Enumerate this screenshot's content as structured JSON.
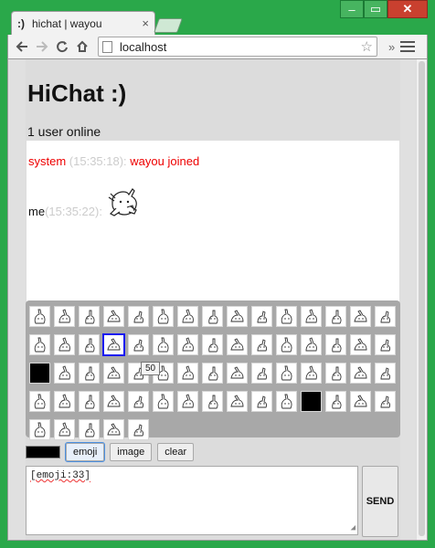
{
  "browser": {
    "tab_favicon": ":)",
    "tab_title": "hichat | wayou",
    "tab_close": "×",
    "window_min": "–",
    "window_max": "▭",
    "window_close": "✕",
    "url": "localhost",
    "ext_label": "»"
  },
  "page": {
    "title": "HiChat :)",
    "status": "1 user online",
    "messages": [
      {
        "user": "system",
        "time": "(15:35:18):",
        "text": "wayou joined"
      },
      {
        "user": "me",
        "time": "(15:35:22):"
      }
    ],
    "emoji_tooltip": "50",
    "controls": {
      "emoji_label": "emoji",
      "image_label": "image",
      "clear_label": "clear"
    },
    "input_value": "[emoji:33]",
    "send_label": "SEND"
  },
  "colors": {
    "frame": "#2aa84a",
    "system_text": "#e00000",
    "timestamp": "#cccccc",
    "selection": "#1a1af0"
  }
}
